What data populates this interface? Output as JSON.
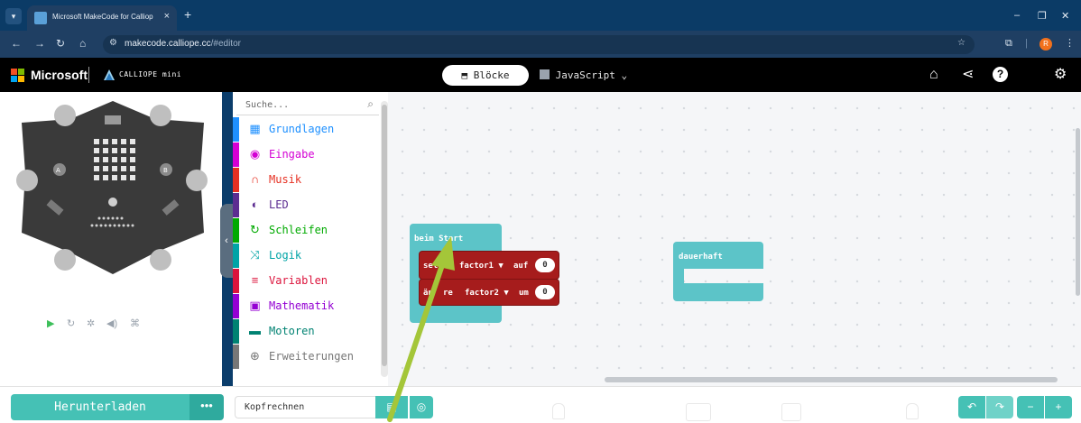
{
  "browser": {
    "tab_title": "Microsoft MakeCode for Calliope",
    "tab_close": "×",
    "new_tab": "+",
    "url_host": "makecode.calliope.cc",
    "url_path": "/#editor",
    "win_minimize": "–",
    "win_restore": "❐",
    "win_close": "✕",
    "profile_initial": "R"
  },
  "header": {
    "ms_brand": "Microsoft",
    "product": "CALLIOPE mini",
    "mode_blocks": "Blöcke",
    "mode_js": "JavaScript"
  },
  "simulator": {
    "controls": [
      "▶",
      "↻",
      "✲",
      "◀)",
      "⌘"
    ]
  },
  "toolbox": {
    "search_placeholder": "Suche...",
    "categories": [
      {
        "label": "Grundlagen",
        "color": "#1e90ff",
        "icon": "grid-icon"
      },
      {
        "label": "Eingabe",
        "color": "#d400d4",
        "icon": "circle-dot-icon"
      },
      {
        "label": "Musik",
        "color": "#e63022",
        "icon": "headphones-icon"
      },
      {
        "label": "LED",
        "color": "#5c2d91",
        "icon": "toggle-icon"
      },
      {
        "label": "Schleifen",
        "color": "#00aa00",
        "icon": "refresh-icon"
      },
      {
        "label": "Logik",
        "color": "#00a4a6",
        "icon": "shuffle-icon"
      },
      {
        "label": "Variablen",
        "color": "#dc143c",
        "icon": "list-icon"
      },
      {
        "label": "Mathematik",
        "color": "#9400d3",
        "icon": "calculator-icon"
      },
      {
        "label": "Motoren",
        "color": "#008272",
        "icon": "car-icon"
      },
      {
        "label": "Erweiterungen",
        "color": "#777777",
        "icon": "plus-circle-icon"
      }
    ]
  },
  "workspace": {
    "on_start_label": "beim Start",
    "set_label_a": "set",
    "set_label_b": "n",
    "set_var": "factor1",
    "set_to": "auf",
    "set_value": "0",
    "change_label_a": "än",
    "change_label_b": "re",
    "change_var": "factor2",
    "change_by": "um",
    "change_value": "0",
    "forever_label": "dauerhaft"
  },
  "bottom": {
    "download": "Herunterladen",
    "download_more": "•••",
    "project_name": "Kopfrechnen"
  },
  "colors": {
    "accent": "#45c1b5",
    "hat_block": "#5cc4c8",
    "variable_block": "#a61c1c",
    "arrow": "#a4c639"
  }
}
